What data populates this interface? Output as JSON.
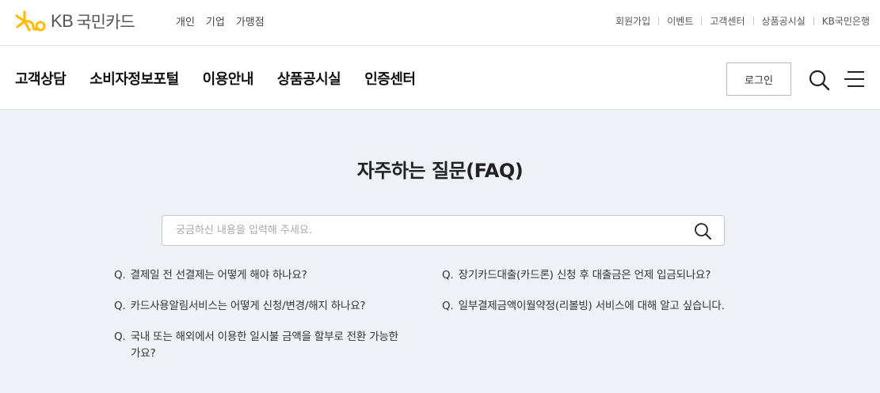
{
  "brand": {
    "kb": "KB",
    "name": "국민카드",
    "accent_color": "#ffbc00"
  },
  "segment_nav": [
    "개인",
    "기업",
    "가맹점"
  ],
  "utility_nav": [
    "회원가입",
    "이벤트",
    "고객센터",
    "상품공시실",
    "KB국민은행"
  ],
  "gnb": {
    "menu": [
      "고객상담",
      "소비자정보포털",
      "이용안내",
      "상품공시실",
      "인증센터"
    ],
    "login_label": "로그인"
  },
  "faq": {
    "title": "자주하는 질문(FAQ)",
    "search_placeholder": "궁금하신 내용을 입력해 주세요.",
    "search_value": "",
    "left": [
      {
        "prefix": "Q.",
        "text": "결제일 전 선결제는 어떻게 해야 하나요?"
      },
      {
        "prefix": "Q.",
        "text": "카드사용알림서비스는 어떻게 신청/변경/해지 하나요?"
      },
      {
        "prefix": "Q.",
        "text": "국내 또는 해외에서 이용한 일시불 금액을 할부로 전환 가능한가요?"
      }
    ],
    "right": [
      {
        "prefix": "Q.",
        "text": "장기카드대출(카드론) 신청 후 대출금은 언제 입금되나요?"
      },
      {
        "prefix": "Q.",
        "text": "일부결제금액이월약정(리볼빙) 서비스에 대해 알고 싶습니다."
      }
    ]
  }
}
